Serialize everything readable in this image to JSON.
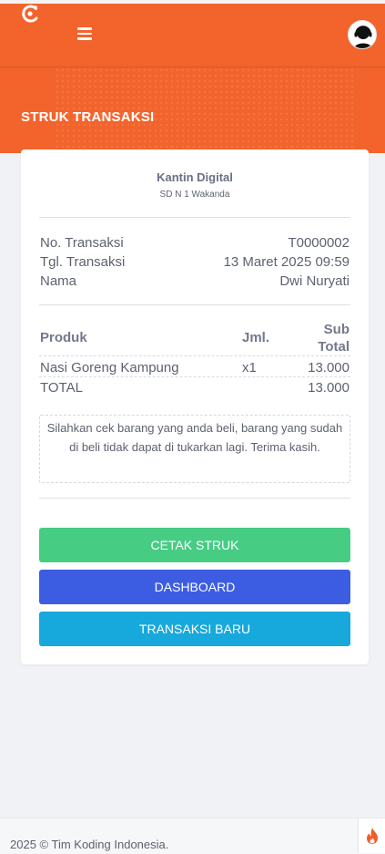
{
  "app": {
    "title": "STRUK TRANSAKSI"
  },
  "icons": {
    "logo": "logo-icon",
    "menu": "hamburger-menu-icon",
    "avatar": "user-headset-avatar",
    "fire": "fire-icon"
  },
  "colors": {
    "header": "#f2642c",
    "green": "#47cc84",
    "blue": "#3c5de2",
    "cyan": "#17a8dc"
  },
  "receipt": {
    "store_name": "Kantin Digital",
    "store_subtitle": "SD N 1 Wakanda",
    "info": [
      {
        "label": "No. Transaksi",
        "value": "T0000002"
      },
      {
        "label": "Tgl. Transaksi",
        "value": "13 Maret 2025 09:59"
      },
      {
        "label": "Nama",
        "value": "Dwi Nuryati"
      }
    ],
    "table": {
      "headers": {
        "product": "Produk",
        "qty": "Jml.",
        "subtotal_line1": "Sub",
        "subtotal_line2": "Total"
      },
      "items": [
        {
          "product": "Nasi Goreng Kampung",
          "qty": "x1",
          "subtotal": "13.000"
        }
      ],
      "total_label": "TOTAL",
      "total_value": "13.000"
    },
    "notice": "Silahkan cek barang yang anda beli, barang yang sudah di beli tidak dapat di tukarkan lagi. Terima kasih."
  },
  "buttons": {
    "print": "CETAK STRUK",
    "dashboard": "DASHBOARD",
    "new_transaction": "TRANSAKSI BARU"
  },
  "footer": {
    "text": "2025 © Tim Koding Indonesia."
  }
}
